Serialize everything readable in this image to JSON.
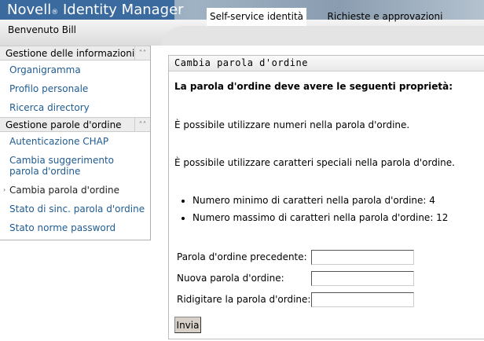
{
  "header": {
    "brand": "Novell",
    "reg": "®",
    "product": "Identity Manager"
  },
  "bar": {
    "welcome": "Benvenuto Bill",
    "tabs": [
      {
        "label": "Self-service identità",
        "active": true
      },
      {
        "label": "Richieste e approvazioni",
        "active": false
      }
    ]
  },
  "sidebar": {
    "sections": [
      {
        "title": "Gestione delle informazioni",
        "items": [
          "Organigramma",
          "Profilo personale",
          "Ricerca directory"
        ]
      },
      {
        "title": "Gestione parole d'ordine",
        "items": [
          "Autenticazione CHAP",
          "Cambia suggerimento parola d'ordine",
          "Cambia parola d'ordine",
          "Stato di sinc. parola d'ordine",
          "Stato norme password"
        ]
      }
    ],
    "collapse_icon": "double-chevron-up"
  },
  "panel": {
    "title": "Cambia parola d'ordine",
    "intro": "La parola d'ordine deve avere le seguenti proprietà:",
    "rules": [
      "È possibile utilizzare numeri nella parola d'ordine.",
      "È possibile utilizzare caratteri speciali nella parola d'ordine."
    ],
    "bullets": [
      "Numero minimo di caratteri nella parola d'ordine: 4",
      "Numero massimo di caratteri nella parola d'ordine: 12"
    ],
    "fields": [
      {
        "label": "Parola d'ordine precedente:",
        "value": ""
      },
      {
        "label": "Nuova parola d'ordine:",
        "value": ""
      },
      {
        "label": "Ridigitare la parola d'ordine:",
        "value": ""
      }
    ],
    "submit": "Invia"
  }
}
